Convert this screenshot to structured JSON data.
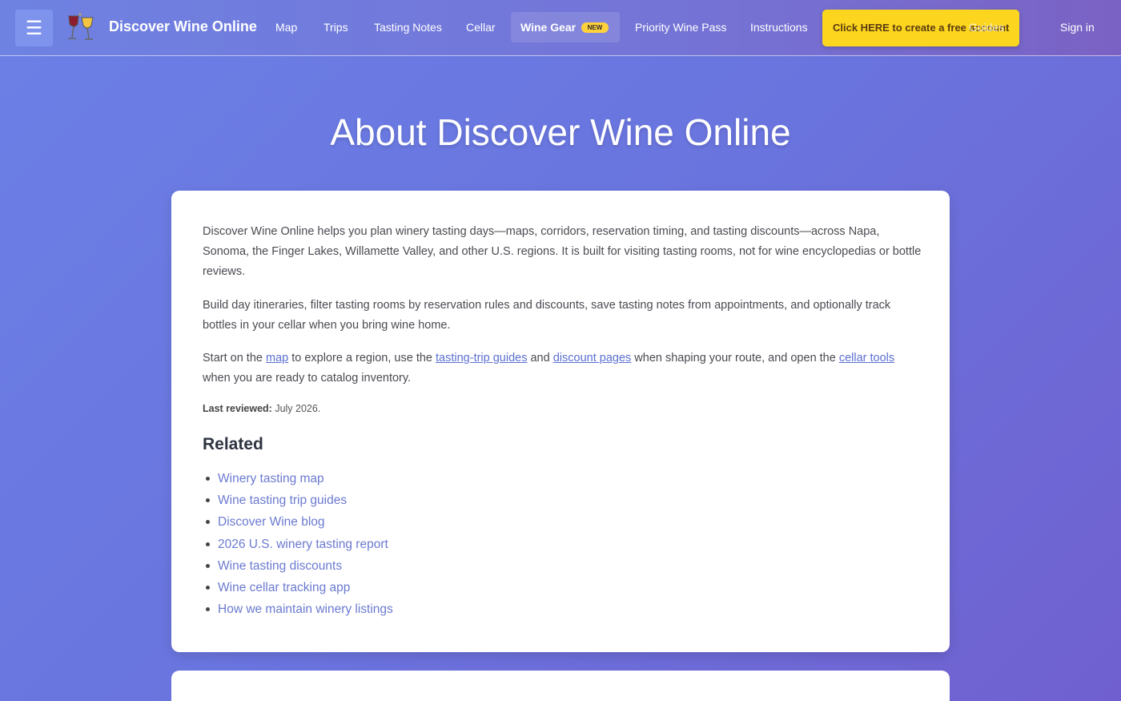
{
  "nav": {
    "menu_icon": "hamburger-icon",
    "brand": "Discover Wine Online",
    "links": [
      "Map",
      "Trips",
      "Tasting Notes",
      "Cellar"
    ],
    "wine_gear": "Wine Gear",
    "new_badge": "NEW",
    "priority": "Priority Wine Pass",
    "instructions": "Instructions",
    "cta": "Click HERE to create a free account",
    "guides_overlay": "Guides",
    "sign_in": "Sign in"
  },
  "hero": {
    "title": "About Discover Wine Online"
  },
  "about": {
    "p1": "Discover Wine Online helps you plan winery tasting days—maps, corridors, reservation timing, and tasting discounts—across Napa, Sonoma, the Finger Lakes, Willamette Valley, and other U.S. regions. It is built for visiting tasting rooms, not for wine encyclopedias or bottle reviews.",
    "p2": "Build day itineraries, filter tasting rooms by reservation rules and discounts, save tasting notes from appointments, and optionally track bottles in your cellar when you bring wine home.",
    "p3": {
      "t1": "Start on the ",
      "map_link": "map",
      "t2": " to explore a region, use the ",
      "guides_link": "tasting-trip guides",
      "t3": " and ",
      "discount_link": "discount pages",
      "t4": " when shaping your route, and open the ",
      "cellar_link": "cellar tools",
      "t5": " when you are ready to catalog inventory."
    },
    "reviewed_label": "Last reviewed:",
    "reviewed_value": " July 2026."
  },
  "related": {
    "heading": "Related",
    "items": [
      "Winery tasting map",
      "Wine tasting trip guides",
      "Discover Wine blog",
      "2026 U.S. winery tasting report",
      "Wine tasting discounts",
      "Wine cellar tracking app",
      "How we maintain winery listings"
    ]
  }
}
